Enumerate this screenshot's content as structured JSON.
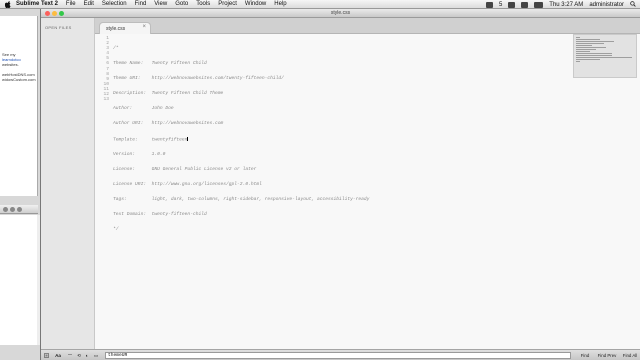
{
  "menubar": {
    "app_name": "Sublime Text 2",
    "items": [
      "File",
      "Edit",
      "Selection",
      "Find",
      "View",
      "Goto",
      "Tools",
      "Project",
      "Window",
      "Help"
    ],
    "tray_count": "5",
    "clock": "Thu 3:27 AM",
    "user": "administrator"
  },
  "background_window": {
    "lines": [
      "See my",
      "learndotco",
      "websites.",
      "",
      "webHostDNS.com",
      "widowCustom.com"
    ]
  },
  "window": {
    "title": "style.css"
  },
  "sidebar": {
    "label": "OPEN FILES"
  },
  "tabs": [
    {
      "name": "style.css",
      "close_glyph": "×"
    }
  ],
  "editor": {
    "lines": [
      "/*",
      "Theme Name:   Twenty Fifteen Child",
      "Theme URI:    http://webnovawebsites.com/twenty-fifteen-child/",
      "Description:  Twenty Fifteen Child Theme",
      "Author:       John Doe",
      "Author URI:   http://webnovawebsites.com",
      "Template:     twentyfifteen",
      "Version:      1.0.0",
      "License:      GNU General Public License v2 or later",
      "License URI:  http://www.gnu.org/licenses/gpl-2.0.html",
      "Tags:         light, dark, two-columns, right-sidebar, responsive-layout, accessibility-ready",
      "Text Domain:  twenty-fifteen-child",
      "*/"
    ],
    "cursor_line": 7
  },
  "find_panel": {
    "options": [
      "Aa",
      "\"\"",
      "⟲",
      "◐",
      "▭"
    ],
    "query": "themeUR",
    "find_label": "Find",
    "find_prev_label": "Find Prev",
    "find_all_label": "Find All"
  },
  "colors": {
    "editor_bg": "#f8f8f8",
    "comment_text": "#8a8a8a",
    "gutter_text": "#a0a0a0",
    "close_red": "#fc605c",
    "minimize_yellow": "#fdbc40",
    "zoom_green": "#34c84a"
  }
}
